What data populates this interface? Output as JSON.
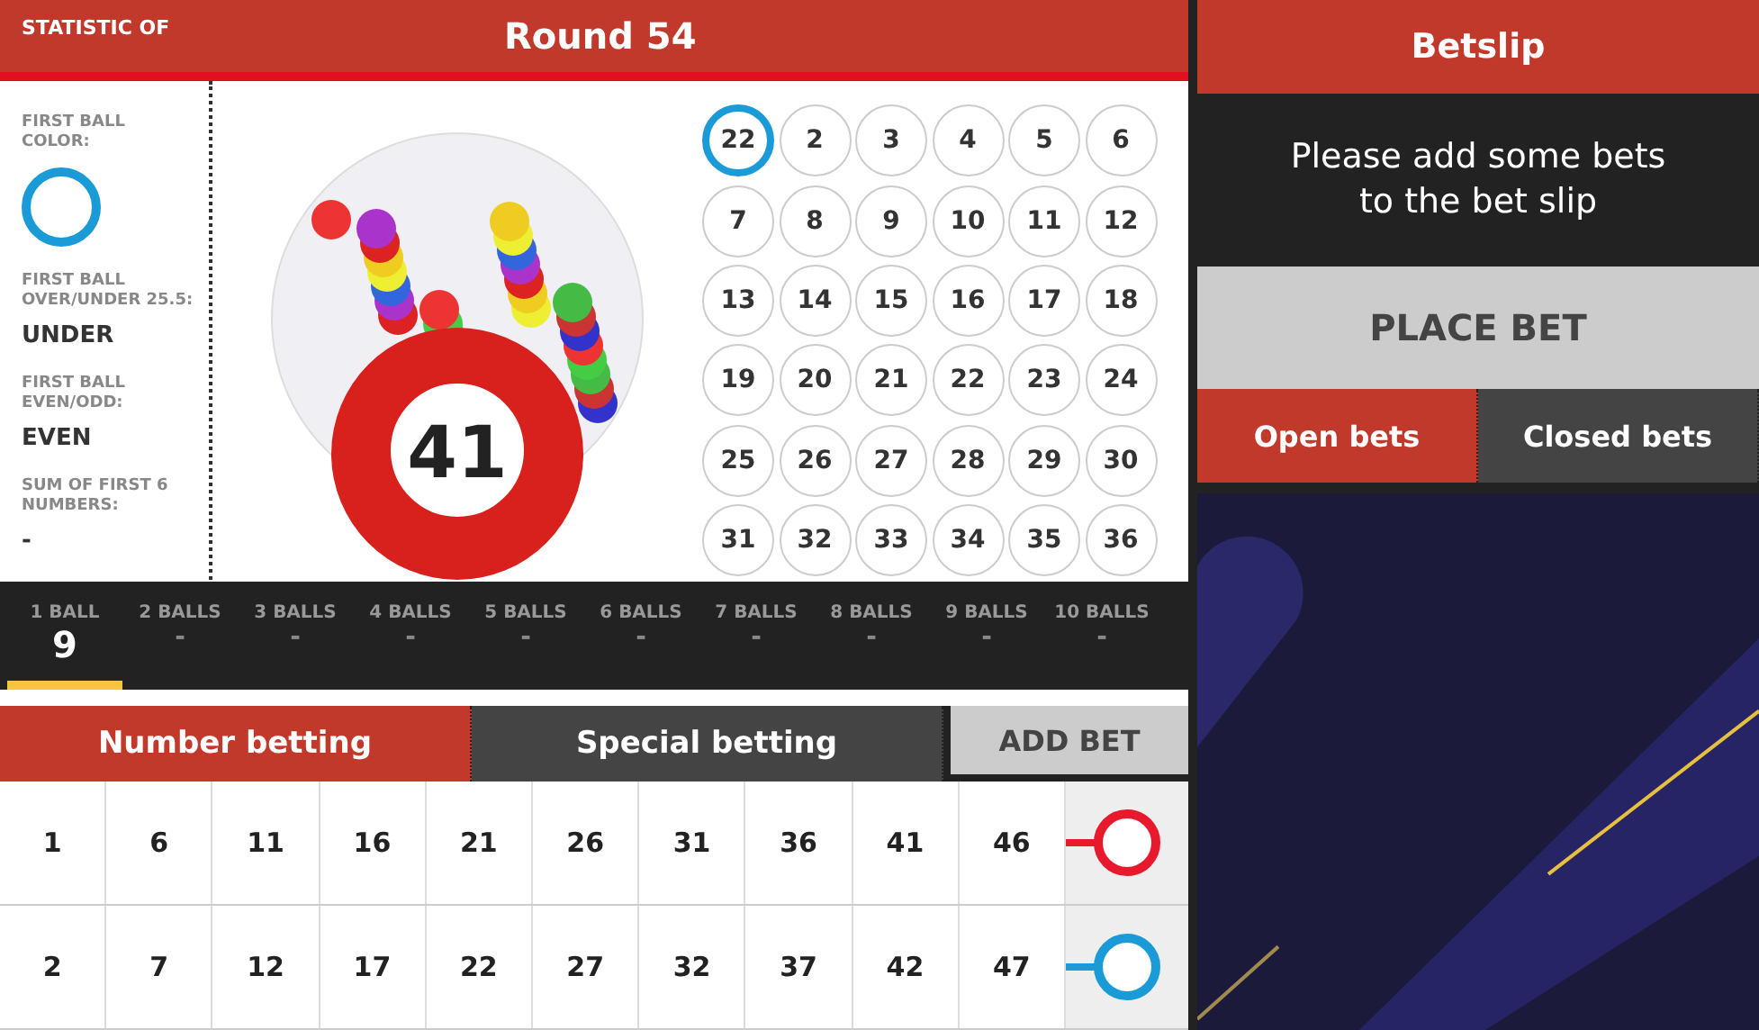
{
  "header": {
    "statistic_label": "STATISTIC OF",
    "round_title": "Round 54"
  },
  "stats": [
    {
      "kind": "color",
      "label": "FIRST BALL COLOR:",
      "color": "#1a9ad6"
    },
    {
      "kind": "text",
      "label": "FIRST BALL OVER/UNDER 25.5:",
      "value": "UNDER"
    },
    {
      "kind": "text",
      "label": "FIRST BALL EVEN/ODD:",
      "value": "EVEN"
    },
    {
      "kind": "text",
      "label": "SUM OF FIRST 6 NUMBERS:",
      "value": "-"
    }
  ],
  "drawn_ball": "41",
  "drawn_numbers": [
    {
      "number": "22",
      "selected": true
    },
    {
      "number": "2",
      "selected": false
    },
    {
      "number": "3",
      "selected": false
    },
    {
      "number": "4",
      "selected": false
    },
    {
      "number": "5",
      "selected": false
    },
    {
      "number": "6",
      "selected": false
    },
    {
      "number": "7",
      "selected": false
    },
    {
      "number": "8",
      "selected": false
    },
    {
      "number": "9",
      "selected": false
    },
    {
      "number": "10",
      "selected": false
    },
    {
      "number": "11",
      "selected": false
    },
    {
      "number": "12",
      "selected": false
    },
    {
      "number": "13",
      "selected": false
    },
    {
      "number": "14",
      "selected": false
    },
    {
      "number": "15",
      "selected": false
    },
    {
      "number": "16",
      "selected": false
    },
    {
      "number": "17",
      "selected": false
    },
    {
      "number": "18",
      "selected": false
    },
    {
      "number": "19",
      "selected": false
    },
    {
      "number": "20",
      "selected": false
    },
    {
      "number": "21",
      "selected": false
    },
    {
      "number": "22",
      "selected": false
    },
    {
      "number": "23",
      "selected": false
    },
    {
      "number": "24",
      "selected": false
    },
    {
      "number": "25",
      "selected": false
    },
    {
      "number": "26",
      "selected": false
    },
    {
      "number": "27",
      "selected": false
    },
    {
      "number": "28",
      "selected": false
    },
    {
      "number": "29",
      "selected": false
    },
    {
      "number": "30",
      "selected": false
    },
    {
      "number": "31",
      "selected": false
    },
    {
      "number": "32",
      "selected": false
    },
    {
      "number": "33",
      "selected": false
    },
    {
      "number": "34",
      "selected": false
    },
    {
      "number": "35",
      "selected": false
    },
    {
      "number": "36",
      "selected": false
    }
  ],
  "ball_tabs": [
    {
      "label": "1 BALL",
      "value": "9",
      "selected": true
    },
    {
      "label": "2 BALLS",
      "value": "-",
      "selected": false
    },
    {
      "label": "3 BALLS",
      "value": "-",
      "selected": false
    },
    {
      "label": "4 BALLS",
      "value": "-",
      "selected": false
    },
    {
      "label": "5 BALLS",
      "value": "-",
      "selected": false
    },
    {
      "label": "6 BALLS",
      "value": "-",
      "selected": false
    },
    {
      "label": "7 BALLS",
      "value": "-",
      "selected": false
    },
    {
      "label": "8 BALLS",
      "value": "-",
      "selected": false
    },
    {
      "label": "9 BALLS",
      "value": "-",
      "selected": false
    },
    {
      "label": "10 BALLS",
      "value": "-",
      "selected": false
    }
  ],
  "betting_tabs": [
    {
      "label": "Number betting",
      "selected": true
    },
    {
      "label": "Special betting",
      "selected": false
    }
  ],
  "add_bet_button": "ADD BET",
  "bet_rows": [
    {
      "numbers": [
        "1",
        "6",
        "11",
        "16",
        "21",
        "26",
        "31",
        "36",
        "41",
        "46"
      ],
      "color": "#e8192c"
    },
    {
      "numbers": [
        "2",
        "7",
        "12",
        "17",
        "22",
        "27",
        "32",
        "37",
        "42",
        "47"
      ],
      "color": "#1a9ad6"
    }
  ],
  "betslip": {
    "title": "Betslip",
    "message": "Please add some bets to the bet slip",
    "place_bet_button": "PLACE BET",
    "tabs": [
      {
        "label": "Open bets",
        "selected": true
      },
      {
        "label": "Closed bets",
        "selected": false
      }
    ]
  }
}
